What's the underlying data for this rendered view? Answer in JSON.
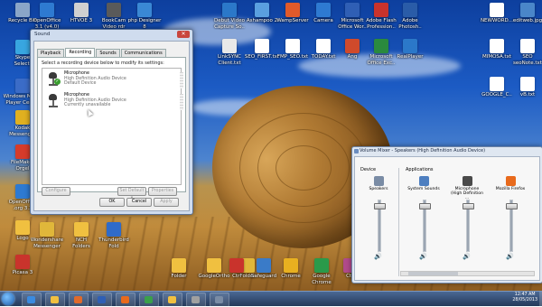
{
  "desktop": {
    "icons_left": [
      {
        "label": "Recycle Bin",
        "color": "#8aa6c8"
      },
      {
        "label": "Skype\nSelect.",
        "color": "#38a6e0"
      },
      {
        "label": "Windows Media\nPlayer Center",
        "color": "#3b6cc7"
      },
      {
        "label": "Kodak\nMessenger",
        "color": "#e0b020"
      },
      {
        "label": "FileMaker\nOrgel",
        "color": "#d63b2b"
      },
      {
        "label": "OpenOffice\n.org 3.2",
        "color": "#2e7ad1"
      },
      {
        "label": "Logo",
        "color": "#f0c040"
      },
      {
        "label": "Picasa 3",
        "color": "#c9332c"
      }
    ],
    "icons_row2": [
      {
        "label": "OpenOffice\n3.1 (v4.0)",
        "color": "#2e7ad1"
      },
      {
        "label": "HTVOE 3",
        "color": "#d0d0d0"
      },
      {
        "label": "BookCam\nVideo rdr",
        "color": "#5a5a5a"
      },
      {
        "label": "php Designer\n8",
        "color": "#3a88d4"
      }
    ],
    "icons_middle_row": [
      {
        "label": "Wondershare\nMessenger",
        "color": "#e0b73a"
      },
      {
        "label": "NCH\nFolders",
        "color": "#f0c040"
      },
      {
        "label": "Thunderbird\nFold",
        "color": "#2f6bc9"
      },
      {
        "label": "Folder",
        "color": "#f0c040"
      },
      {
        "label": "GoogleOrtho",
        "color": "#f0c040"
      },
      {
        "label": "Folder",
        "color": "#e0b73a"
      }
    ],
    "icons_top": [
      {
        "label": "Debut Video\nCapture So..",
        "color": "#2b78c9"
      },
      {
        "label": "Ashampoo 2",
        "color": "#5aa0e0"
      },
      {
        "label": "WampServer",
        "color": "#e05a2b"
      },
      {
        "label": "Camera",
        "color": "#2e7ad1"
      },
      {
        "label": "Microsoft\nOffice Wor..",
        "color": "#2f5fb5"
      },
      {
        "label": "Adobe Flash\nProfession..",
        "color": "#c9332c"
      },
      {
        "label": "Adobe\nPhotosh..",
        "color": "#2a5ca8"
      },
      {
        "label": "LinkSYNC\nClient.txt",
        "color": "#e8e8e8"
      },
      {
        "label": "SEO_FIRST.txt",
        "color": "#ffffff"
      },
      {
        "label": "FMP_SEO.txt",
        "color": "#ffffff"
      },
      {
        "label": "TODAY.txt",
        "color": "#ffffff"
      },
      {
        "label": "Ang",
        "color": "#d04a2b"
      },
      {
        "label": "Microsoft\nOffice Exc..",
        "color": "#2a8a3e"
      },
      {
        "label": "RealPlayer",
        "color": "#2b78c9"
      }
    ],
    "icons_right": [
      {
        "label": "NEWWORD...",
        "color": "#ffffff"
      },
      {
        "label": "editweb.jpg",
        "color": "#4a86c9"
      },
      {
        "label": "MIMOSA.txt",
        "color": "#ffffff"
      },
      {
        "label": "SEO\nseoNote.txt",
        "color": "#ffffff"
      },
      {
        "label": "GOOGLE_C..",
        "color": "#ffffff"
      },
      {
        "label": "vB.txt",
        "color": "#ffffff"
      }
    ],
    "icons_bottom": [
      {
        "label": "Ctrl",
        "color": "#c9332c"
      },
      {
        "label": "Safeguard",
        "color": "#3a7bc8"
      },
      {
        "label": "Chrome",
        "color": "#e8b020"
      },
      {
        "label": "Google\nChrome",
        "color": "#2a9a4a"
      },
      {
        "label": "Ctrl",
        "color": "#b04a8a"
      }
    ]
  },
  "sound_dialog": {
    "title": "Sound",
    "close_glyph": "✕",
    "tabs": [
      "Playback",
      "Recording",
      "Sounds",
      "Communications"
    ],
    "active_tab": "Recording",
    "instruction": "Select a recording device below to modify its settings:",
    "devices": [
      {
        "name": "Microphone",
        "driver": "High Definition Audio Device",
        "status": "Default Device",
        "default": true
      },
      {
        "name": "Microphone",
        "driver": "High Definition Audio Device",
        "status": "Currently unavailable",
        "default": false
      }
    ],
    "check_glyph": "✓",
    "buttons": {
      "configure": "Configure",
      "set_default": "Set Default ▾",
      "properties": "Properties",
      "ok": "OK",
      "cancel": "Cancel",
      "apply": "Apply"
    }
  },
  "volume_mixer": {
    "title": "Volume Mixer - Speakers (High Definition Audio Device)",
    "device_header": "Device",
    "apps_header": "Applications",
    "channels": [
      {
        "label": "Speakers",
        "level": 0.95,
        "color": "#7a8ca5"
      },
      {
        "label": "System Sounds",
        "level": 0.95,
        "color": "#4e7fc0"
      },
      {
        "label": "Microphone\n(High Definition ...",
        "level": 0.95,
        "color": "#4a4a4a"
      },
      {
        "label": "Mozilla Firefox",
        "level": 0.95,
        "color": "#e86a1c"
      }
    ],
    "speaker_glyph": "🔊"
  },
  "taskbar": {
    "clock_time": "12:47 AM",
    "clock_date": "28/05/2013",
    "items": [
      {
        "name": "ie",
        "color": "#3a8be0"
      },
      {
        "name": "explorer",
        "color": "#f0c040"
      },
      {
        "name": "media",
        "color": "#e06a2b"
      },
      {
        "name": "word",
        "color": "#2f5fb5"
      },
      {
        "name": "firefox",
        "color": "#e86a1c"
      },
      {
        "name": "chrome",
        "color": "#3aa04a"
      },
      {
        "name": "folder",
        "color": "#f0c040"
      },
      {
        "name": "settings",
        "color": "#a0a0a0"
      },
      {
        "name": "sound",
        "color": "#7a8ca5"
      }
    ]
  }
}
